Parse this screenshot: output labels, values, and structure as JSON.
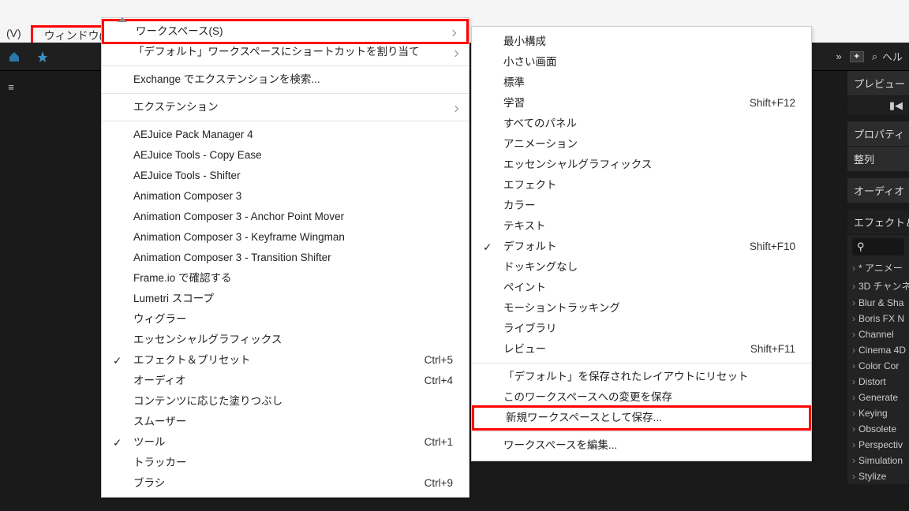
{
  "menubar": {
    "v": "(V)",
    "w": "ウィンドウ(W)"
  },
  "toolbar": {
    "search_label": "ヘル"
  },
  "menu1": {
    "workspace": {
      "label": "ワークスペース(S)"
    },
    "assign": {
      "label": "「デフォルト」ワークスペースにショートカットを割り当て"
    },
    "exchange": {
      "label": "Exchange でエクステンションを検索..."
    },
    "extension": {
      "label": "エクステンション"
    },
    "p1": "AEJuice Pack Manager 4",
    "p2": "AEJuice Tools - Copy Ease",
    "p3": "AEJuice Tools - Shifter",
    "p4": "Animation Composer 3",
    "p5": "Animation Composer 3 - Anchor Point Mover",
    "p6": "Animation Composer 3 - Keyframe Wingman",
    "p7": "Animation Composer 3 - Transition Shifter",
    "p8": "Frame.io で確認する",
    "p9": "Lumetri スコープ",
    "p10": "ウィグラー",
    "p11": "エッセンシャルグラフィックス",
    "p12": {
      "label": "エフェクト＆プリセット",
      "short": "Ctrl+5"
    },
    "p13": {
      "label": "オーディオ",
      "short": "Ctrl+4"
    },
    "p14": "コンテンツに応じた塗りつぶし",
    "p15": "スムーザー",
    "p16": {
      "label": "ツール",
      "short": "Ctrl+1"
    },
    "p17": "トラッカー",
    "p18": {
      "label": "ブラシ",
      "short": "Ctrl+9"
    }
  },
  "menu2": {
    "w1": "最小構成",
    "w2": "小さい画面",
    "w3": "標準",
    "w4": {
      "label": "学習",
      "short": "Shift+F12"
    },
    "w5": "すべてのパネル",
    "w6": "アニメーション",
    "w7": "エッセンシャルグラフィックス",
    "w8": "エフェクト",
    "w9": "カラー",
    "w10": "テキスト",
    "w11": {
      "label": "デフォルト",
      "short": "Shift+F10"
    },
    "w12": "ドッキングなし",
    "w13": "ペイント",
    "w14": "モーショントラッキング",
    "w15": "ライブラリ",
    "w16": {
      "label": "レビュー",
      "short": "Shift+F11"
    },
    "r1": "「デフォルト」を保存されたレイアウトにリセット",
    "r2": "このワークスペースへの変更を保存",
    "r3": "新規ワークスペースとして保存...",
    "r4": "ワークスペースを編集..."
  },
  "right": {
    "preview": "プレビュー",
    "property": "プロパティ",
    "align": "整列",
    "audio": "オーディオ",
    "effects": "エフェクト＆",
    "search_glyph": "⚲",
    "list": [
      "* アニメー",
      "3D チャンネ",
      "Blur & Sha",
      "Boris FX N",
      "Channel",
      "Cinema 4D",
      "Color Cor",
      "Distort",
      "Generate",
      "Keying",
      "Obsolete",
      "Perspectiv",
      "Simulation",
      "Stylize"
    ]
  }
}
